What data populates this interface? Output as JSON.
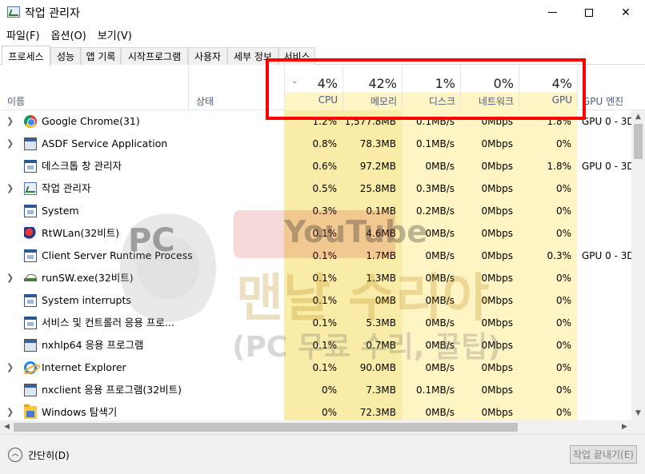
{
  "window": {
    "title": "작업 관리자",
    "min_label": "–",
    "max_label": "",
    "close_label": "✕"
  },
  "menu": [
    "파일(F)",
    "옵션(O)",
    "보기(V)"
  ],
  "tabs": [
    "프로세스",
    "성능",
    "앱 기록",
    "시작프로그램",
    "사용자",
    "세부 정보",
    "서비스"
  ],
  "active_tab": "프로세스",
  "columns": {
    "name": "이름",
    "status": "상태",
    "cpu": {
      "pct": "4%",
      "label": "CPU"
    },
    "memory": {
      "pct": "42%",
      "label": "메모리"
    },
    "disk": {
      "pct": "1%",
      "label": "디스크"
    },
    "network": {
      "pct": "0%",
      "label": "네트워크"
    },
    "gpu": {
      "pct": "4%",
      "label": "GPU"
    },
    "gpu_engine": "GPU 엔진"
  },
  "colors": {
    "cpu_heat_light": "#fff4c4",
    "cpu_heat": "#f9eca8",
    "mem_heat": "#f9eca8",
    "highlight_border": "#ff0000"
  },
  "processes": [
    {
      "name": "Google Chrome(31)",
      "icon": "chrome-icon",
      "expandable": true,
      "cpu": "1.2%",
      "mem": "1,577.8MB",
      "disk": "0.1MB/s",
      "net": "0Mbps",
      "gpu": "1.8%",
      "engine": "GPU 0 - 3D"
    },
    {
      "name": "ASDF Service Application",
      "icon": "app-icon",
      "expandable": true,
      "cpu": "0.8%",
      "mem": "78.3MB",
      "disk": "0.1MB/s",
      "net": "0Mbps",
      "gpu": "0%",
      "engine": ""
    },
    {
      "name": "데스크톱 창 관리자",
      "icon": "window-icon",
      "expandable": false,
      "cpu": "0.6%",
      "mem": "97.2MB",
      "disk": "0MB/s",
      "net": "0Mbps",
      "gpu": "1.8%",
      "engine": "GPU 0 - 3D"
    },
    {
      "name": "작업 관리자",
      "icon": "task-manager-icon",
      "expandable": true,
      "cpu": "0.5%",
      "mem": "25.8MB",
      "disk": "0.3MB/s",
      "net": "0Mbps",
      "gpu": "0%",
      "engine": ""
    },
    {
      "name": "System",
      "icon": "window-icon",
      "expandable": false,
      "cpu": "0.3%",
      "mem": "0.1MB",
      "disk": "0.2MB/s",
      "net": "0Mbps",
      "gpu": "0%",
      "engine": ""
    },
    {
      "name": "RtWLan(32비트)",
      "icon": "rtwlan-icon",
      "expandable": false,
      "cpu": "0.1%",
      "mem": "4.6MB",
      "disk": "0MB/s",
      "net": "0Mbps",
      "gpu": "0%",
      "engine": ""
    },
    {
      "name": "Client Server Runtime Process",
      "icon": "window-icon",
      "expandable": false,
      "cpu": "0.1%",
      "mem": "1.7MB",
      "disk": "0MB/s",
      "net": "0Mbps",
      "gpu": "0.3%",
      "engine": "GPU 0 - 3D"
    },
    {
      "name": "runSW.exe(32비트)",
      "icon": "network-icon",
      "expandable": true,
      "cpu": "0.1%",
      "mem": "1.3MB",
      "disk": "0MB/s",
      "net": "0Mbps",
      "gpu": "0%",
      "engine": ""
    },
    {
      "name": "System interrupts",
      "icon": "window-icon",
      "expandable": false,
      "cpu": "0.1%",
      "mem": "0MB",
      "disk": "0MB/s",
      "net": "0Mbps",
      "gpu": "0%",
      "engine": ""
    },
    {
      "name": "서비스 및 컨트롤러 응용 프로...",
      "icon": "window-icon",
      "expandable": false,
      "cpu": "0.1%",
      "mem": "5.3MB",
      "disk": "0MB/s",
      "net": "0Mbps",
      "gpu": "0%",
      "engine": ""
    },
    {
      "name": "nxhlp64 응용 프로그램",
      "icon": "app-icon",
      "expandable": false,
      "cpu": "0.1%",
      "mem": "0.7MB",
      "disk": "0MB/s",
      "net": "0Mbps",
      "gpu": "0%",
      "engine": ""
    },
    {
      "name": "Internet Explorer",
      "icon": "ie-icon",
      "expandable": true,
      "cpu": "0.1%",
      "mem": "90.0MB",
      "disk": "0MB/s",
      "net": "0Mbps",
      "gpu": "0%",
      "engine": ""
    },
    {
      "name": "nxclient 응용 프로그램(32비트)",
      "icon": "app-icon",
      "expandable": false,
      "cpu": "0%",
      "mem": "7.3MB",
      "disk": "0.1MB/s",
      "net": "0Mbps",
      "gpu": "0%",
      "engine": ""
    },
    {
      "name": "Windows 탐색기",
      "icon": "folder-icon",
      "expandable": true,
      "cpu": "0%",
      "mem": "72.3MB",
      "disk": "0MB/s",
      "net": "0Mbps",
      "gpu": "0%",
      "engine": ""
    }
  ],
  "footer": {
    "fewer_details": "간단히(D)",
    "end_task": "작업 끝내기(E)"
  },
  "watermark": {
    "logo_text": "PC",
    "youtube": "YouTube",
    "title": "맨날 수리야",
    "subtitle": "(PC 무료 수리, 꿀팁)"
  }
}
